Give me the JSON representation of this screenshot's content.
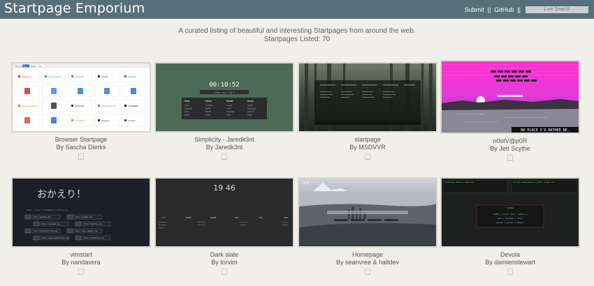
{
  "header": {
    "logo": "Startpage Emporium",
    "submit": "Submit",
    "sep1": "||",
    "github": "GitHub",
    "sep2": "||",
    "search_placeholder": "Live Search"
  },
  "intro": {
    "tagline": "A curated listing of beautiful and interesting Startpages from around the web.",
    "count": "Startpages Listed: 70"
  },
  "cards": [
    {
      "title": "Browser Startpage",
      "by": "By Sascha Dierks",
      "thumb": {
        "tabs": [
          "Browse",
          "Dev",
          "Social",
          "Info"
        ],
        "tiles": [
          "Newsroom",
          "stackoverflow",
          "Minecraft",
          "GitHub",
          "bitbucket",
          "",
          "",
          "",
          "",
          "",
          "Google Analytics",
          "",
          "MDN Web",
          "Google Chrome",
          "CODEPEN",
          "",
          "",
          "Cloudflare",
          "pingdom",
          "prezibox"
        ]
      }
    },
    {
      "title": "Simplicity - Jaredk3nt",
      "by": "By Jaredk3nt",
      "thumb": {
        "clock": "00:10:52",
        "search": "clear sky - 15 F",
        "columns": [
          {
            "head": "Daily",
            "items": [
              "Inbox",
              "Calendar",
              "Drive",
              "Maps"
            ]
          },
          {
            "head": "Media",
            "items": [
              "Youtube",
              "Netflix",
              "Spotify",
              "Twitch"
            ]
          },
          {
            "head": "Reddit",
            "items": [
              "r/news",
              "r/tech",
              "r/gaming",
              "r/pics"
            ]
          },
          {
            "head": "Social",
            "items": [
              "Twitter",
              "Facebook",
              "Discord",
              "Slack"
            ]
          }
        ]
      }
    },
    {
      "title": "startpage",
      "by": "By MSDVVR",
      "thumb": {}
    },
    {
      "title": "n0stV@p0R",
      "by": "By Jett Scythe",
      "thumb": {
        "caption": "NO PLACE I'D RATHER BE."
      }
    },
    {
      "title": "vimstart",
      "by": "By nandavera",
      "thumb": {
        "jp": "おかえり！",
        "line": "home ~ http://nandavera.github.io",
        "rows": [
          [
            "http://github.com",
            "http://reddit.com"
          ],
          [
            "http://youtube.com",
            "http://twitter.com"
          ],
          [
            "http://stackoverflow.com",
            "http://mail.google.com"
          ],
          [
            "http://news.ycombinator.com",
            "http://archlinux.org"
          ]
        ]
      }
    },
    {
      "title": "Dark slate",
      "by": "By torvim",
      "thumb": {
        "time": "19 46",
        "labels": [
          "work",
          "email",
          "social",
          "dev",
          "fun",
          "misc"
        ]
      }
    },
    {
      "title": "Homepage",
      "by": "By seanvree & haltdev",
      "thumb": {
        "temp": "19°F"
      }
    },
    {
      "title": "Devola",
      "by": "By damienstewart",
      "thumb": {
        "left": "Greetings, Devola. Good day.",
        "right": "Current temperature is 21°C. Clear sky.",
        "box_title": "Links",
        "box_rows": [
          "reddit  |  hacker news  |  lobste.rs",
          "mail  |  calendar  |  drive",
          "github  |  gitlab  |  codepen"
        ]
      }
    }
  ],
  "colors": {
    "header": "#566f7a",
    "background": "#f1efe9",
    "text": "#555555"
  },
  "icons": {
    "card_link": "document-icon"
  }
}
